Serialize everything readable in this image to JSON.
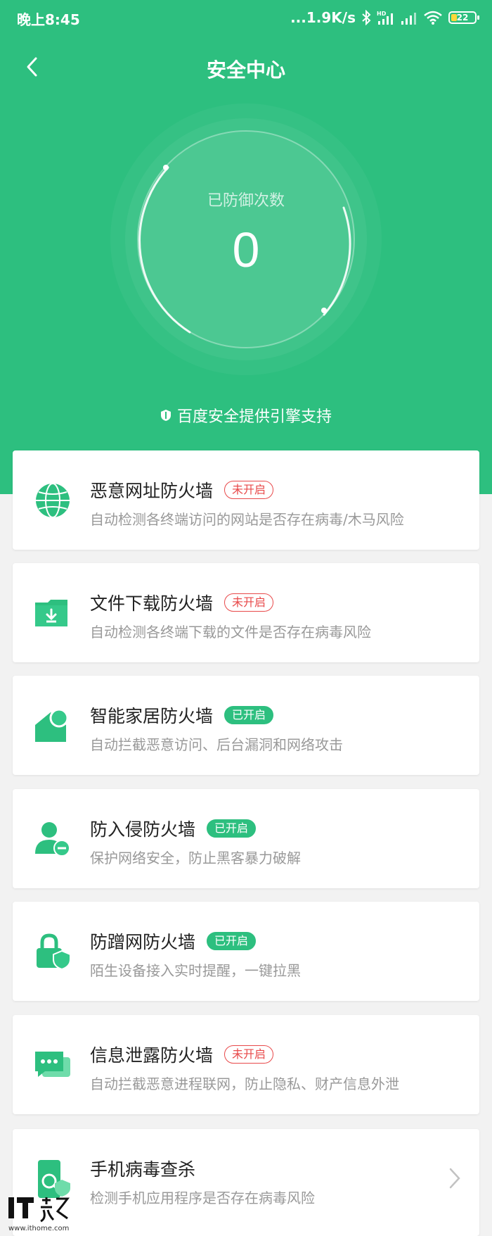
{
  "status_bar": {
    "time": "晚上8:45",
    "network_speed": "...1.9K/s",
    "battery_level": "22",
    "icons": [
      "bluetooth-icon",
      "hd-signal-icon",
      "signal-icon",
      "wifi-icon",
      "battery-icon"
    ]
  },
  "nav": {
    "title": "安全中心",
    "back_icon": "chevron-left-icon"
  },
  "defense": {
    "label": "已防御次数",
    "count": "0"
  },
  "engine_note": "百度安全提供引擎支持",
  "cards": [
    {
      "title": "恶意网址防火墙",
      "badge": "未开启",
      "badge_state": "off",
      "desc": "自动检测各终端访问的网站是否存在病毒/木马风险",
      "icon": "globe-icon"
    },
    {
      "title": "文件下载防火墙",
      "badge": "未开启",
      "badge_state": "off",
      "desc": "自动检测各终端下载的文件是否存在病毒风险",
      "icon": "folder-download-icon"
    },
    {
      "title": "智能家居防火墙",
      "badge": "已开启",
      "badge_state": "on",
      "desc": "自动拦截恶意访问、后台漏洞和网络攻击",
      "icon": "smart-home-icon"
    },
    {
      "title": "防入侵防火墙",
      "badge": "已开启",
      "badge_state": "on",
      "desc": "保护网络安全，防止黑客暴力破解",
      "icon": "user-shield-icon"
    },
    {
      "title": "防蹭网防火墙",
      "badge": "已开启",
      "badge_state": "on",
      "desc": "陌生设备接入实时提醒，一键拉黑",
      "icon": "lock-shield-icon"
    },
    {
      "title": "信息泄露防火墙",
      "badge": "未开启",
      "badge_state": "off",
      "desc": "自动拦截恶意进程联网，防止隐私、财产信息外泄",
      "icon": "chat-bubble-icon"
    },
    {
      "title": "手机病毒查杀",
      "badge": "",
      "badge_state": "none",
      "desc": "检测手机应用程序是否存在病毒风险",
      "icon": "phone-scan-icon"
    }
  ],
  "colors": {
    "brand_green": "#2dbf7f",
    "off_red": "#e8494a"
  },
  "watermark": {
    "site": "www.ithome.com"
  }
}
